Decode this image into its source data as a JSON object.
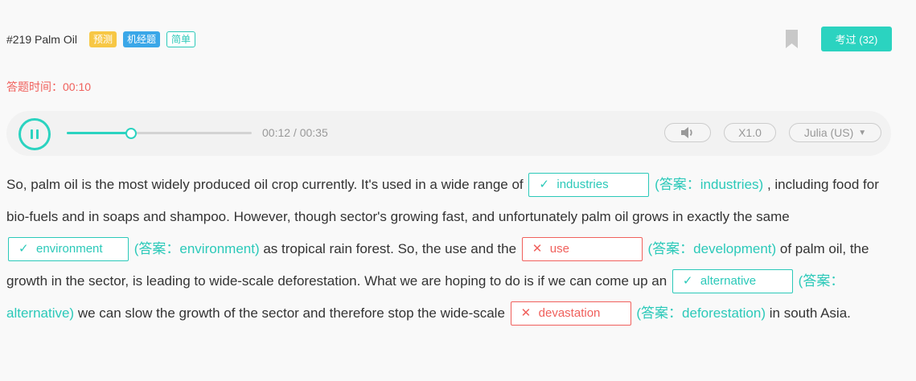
{
  "header": {
    "title": "#219 Palm Oil",
    "badge_predict": "预测",
    "badge_machine": "机经题",
    "badge_easy": "简单",
    "exam_button": "考过 (32)"
  },
  "timer": {
    "label": "答题时间：",
    "value": "00:10"
  },
  "player": {
    "progress": 0.343,
    "time": "00:12 / 00:35",
    "speed": "X1.0",
    "voice": "Julia (US)"
  },
  "passage": {
    "s1": "So, palm oil is the most widely produced oil crop currently. It's used in a wide range of",
    "blank1": {
      "value": "industries",
      "correct": true,
      "answer": "(答案：industries)"
    },
    "s2": ", including food for bio-fuels and in soaps and shampoo. However, though sector's growing fast, and unfortunately palm oil grows in exactly the same",
    "blank2": {
      "value": "environment",
      "correct": true,
      "answer": "(答案：environment)"
    },
    "s3": "as tropical rain forest. So, the use and the",
    "blank3": {
      "value": "use",
      "correct": false,
      "answer": "(答案：development)"
    },
    "s4": "of palm oil, the growth in the sector, is leading to wide-scale deforestation. What we are hoping to do is if we can come up an",
    "blank4": {
      "value": "alternative",
      "correct": true,
      "answer": "(答案：alternative)"
    },
    "s5": "we can slow the growth of the sector and therefore stop the wide-scale",
    "blank5": {
      "value": "devastation",
      "correct": false,
      "answer": "(答案：deforestation)"
    },
    "s6": "in south Asia."
  },
  "icons": {
    "correct": "✓",
    "wrong": "✕"
  },
  "colors": {
    "accent": "#2bd3c0",
    "error": "#f0605c",
    "predict": "#f7c744",
    "machine": "#3aa7e8"
  }
}
